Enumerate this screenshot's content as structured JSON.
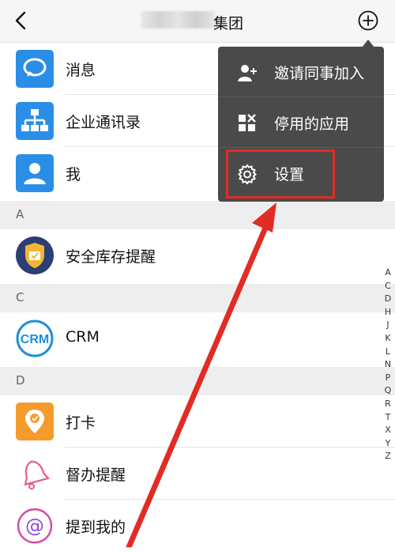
{
  "header": {
    "title_suffix": "集团",
    "blurred_title": true
  },
  "list": [
    {
      "label": "消息",
      "icon": "message-icon"
    },
    {
      "label": "企业通讯录",
      "icon": "org-chart-icon"
    },
    {
      "label": "我",
      "icon": "person-icon"
    }
  ],
  "sections": [
    {
      "letter": "A",
      "items": [
        {
          "label": "安全库存提醒",
          "icon": "shield-badge-icon"
        }
      ]
    },
    {
      "letter": "C",
      "items": [
        {
          "label": "CRM",
          "icon": "crm-icon",
          "icon_text": "CRM"
        }
      ]
    },
    {
      "letter": "D",
      "items": [
        {
          "label": "打卡",
          "icon": "location-check-icon"
        },
        {
          "label": "督办提醒",
          "icon": "bell-icon"
        },
        {
          "label": "提到我的",
          "icon": "at-icon",
          "icon_text": "@"
        }
      ]
    }
  ],
  "index_letters": [
    "A",
    "C",
    "D",
    "H",
    "J",
    "K",
    "L",
    "N",
    "P",
    "Q",
    "R",
    "T",
    "X",
    "Y",
    "Z"
  ],
  "popup_menu": {
    "items": [
      {
        "label": "邀请同事加入",
        "icon": "add-user-icon"
      },
      {
        "label": "停用的应用",
        "icon": "apps-disabled-icon"
      },
      {
        "label": "设置",
        "icon": "gear-icon"
      }
    ],
    "highlighted": "设置"
  },
  "colors": {
    "blue": "#2b8ee6",
    "orange": "#f59b2b",
    "red_annotation": "#e22b25",
    "popup_bg": "#4a4a4a"
  }
}
